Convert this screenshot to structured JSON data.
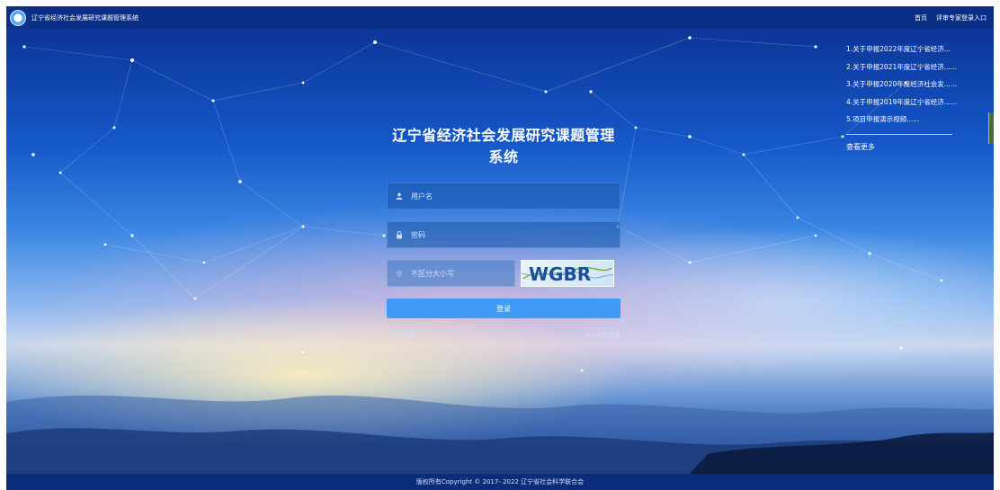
{
  "header": {
    "title": "辽宁省经济社会发展研究课题管理系统",
    "nav": [
      "首页",
      "评审专家登录入口"
    ]
  },
  "login": {
    "title": "辽宁省经济社会发展研究课题管理系统",
    "username_placeholder": "用户名",
    "password_placeholder": "密码",
    "captcha_placeholder": "不区分大小写",
    "captcha_text": "WGBR",
    "submit_label": "登录",
    "forgot_label": "忘记密码?",
    "register_label": ">>点此注册"
  },
  "news": {
    "items": [
      "1.关于申报2022年度辽宁省经济...",
      "2.关于申报2021年度辽宁省经济......",
      "3.关于申报2020年度经济社会发......",
      "4.关于申报2019年度辽宁省经济......",
      "5.项目申报演示视频......"
    ],
    "more_label": "查看更多"
  },
  "footer": {
    "copyright": "版权所有Copyright © 2017- 2022 辽宁省社会科学联合会"
  },
  "colors": {
    "topbar": "#0c2f86",
    "button": "#3f9bf5",
    "footer": "#0b2c79"
  }
}
